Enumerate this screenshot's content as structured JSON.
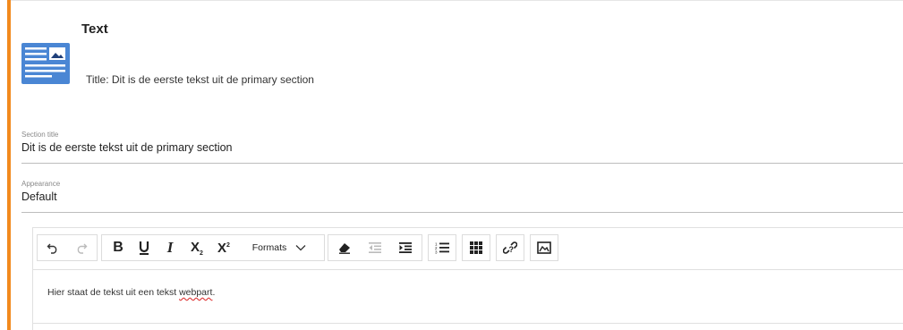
{
  "header": {
    "title": "Text",
    "subtitle": "Title: Dit is de eerste tekst uit de primary section",
    "icon": "document-image-icon"
  },
  "fields": {
    "section_title": {
      "label": "Section title",
      "value": "Dit is de eerste tekst uit de primary section"
    },
    "appearance": {
      "label": "Appearance",
      "value": "Default"
    }
  },
  "toolbar": {
    "undo": "undo-icon",
    "redo": "redo-icon",
    "bold": "bold-icon",
    "underline": "underline-icon",
    "italic": "italic-icon",
    "subscript": "subscript-icon",
    "superscript": "superscript-icon",
    "formats_label": "Formats",
    "clear_formatting": "eraser-icon",
    "outdent": "outdent-icon",
    "indent": "indent-icon",
    "numbered_list": "numbered-list-icon",
    "table": "table-icon",
    "unlink": "unlink-icon",
    "image": "image-icon"
  },
  "editor": {
    "body_before": "Hier staat de tekst uit een tekst ",
    "body_misspelled": "webpart",
    "body_after": "."
  },
  "colors": {
    "accent": "#f28a1e",
    "icon_blue": "#4a86d4"
  }
}
